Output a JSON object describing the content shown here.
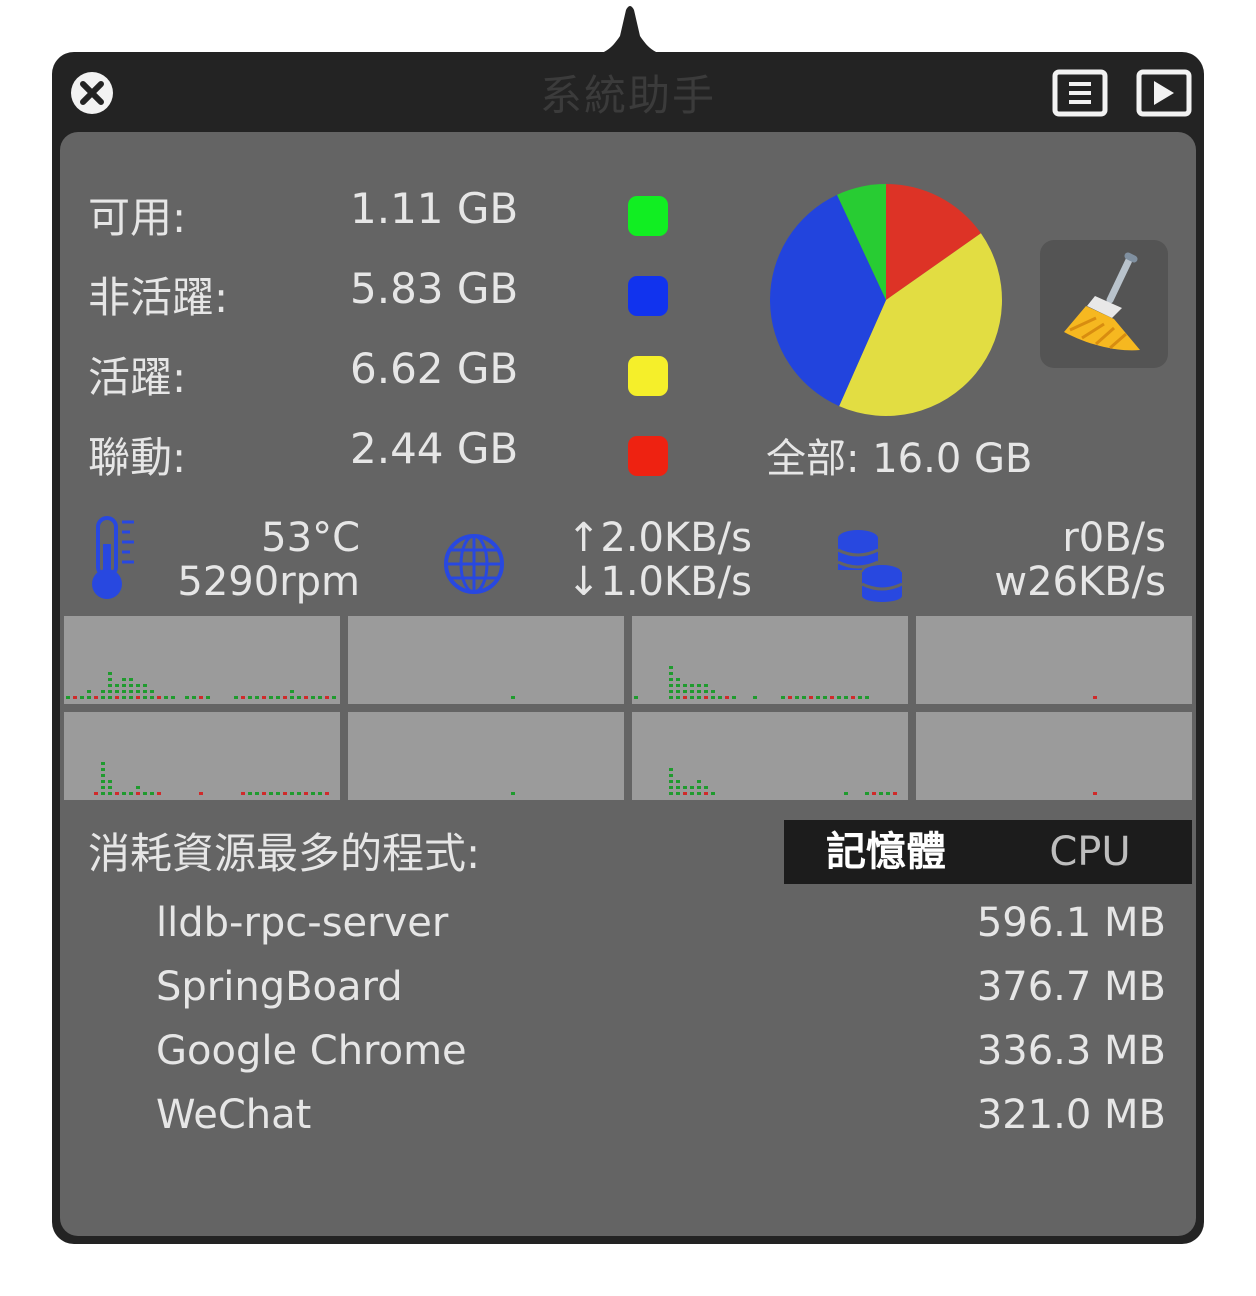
{
  "window": {
    "title": "系統助手"
  },
  "memory": {
    "rows": [
      {
        "label": "可用:",
        "value": "1.11 GB",
        "color": "#11ee22"
      },
      {
        "label": "非活躍:",
        "value": "5.83 GB",
        "color": "#1133ee"
      },
      {
        "label": "活躍:",
        "value": "6.62 GB",
        "color": "#f5ef2a"
      },
      {
        "label": "聯動:",
        "value": "2.44 GB",
        "color": "#ee2211"
      }
    ],
    "total_label": "全部:",
    "total_value": "16.0 GB",
    "pie": {
      "slices": [
        {
          "name": "聯動",
          "value": 2.44,
          "color": "#dd3326"
        },
        {
          "name": "活躍",
          "value": 6.62,
          "color": "#e2dd42"
        },
        {
          "name": "非活躍",
          "value": 5.83,
          "color": "#2244dd"
        },
        {
          "name": "可用",
          "value": 1.11,
          "color": "#28cc33"
        }
      ]
    }
  },
  "sensors": {
    "temperature": "53°C",
    "fan": "5290rpm",
    "net_up": "↑2.0KB/s",
    "net_down": "↓1.0KB/s",
    "disk_read": "r0B/s",
    "disk_write": "w26KB/s"
  },
  "icons": {
    "close": "close-icon",
    "list": "list-icon",
    "play": "play-icon",
    "broom": "broom-icon",
    "thermometer": "thermometer-icon",
    "globe": "globe-icon",
    "disk": "disk-icon"
  },
  "cpu_graphs": {
    "core_bars": [
      [
        1,
        1,
        1,
        2,
        1,
        2,
        5,
        3,
        4,
        4,
        3,
        3,
        2,
        1,
        1,
        1,
        0,
        1,
        1,
        1,
        1,
        0,
        0,
        0,
        1,
        1,
        1,
        1,
        1,
        1,
        1,
        1,
        2,
        1,
        1,
        1,
        1,
        1,
        1
      ],
      [
        0,
        0,
        0,
        0,
        0,
        0,
        0,
        0,
        0,
        0,
        0,
        0,
        0,
        0,
        0,
        0,
        0,
        0,
        0,
        0,
        0,
        0,
        0,
        1,
        0,
        0,
        0,
        0,
        0,
        0,
        0,
        0,
        0,
        0,
        0,
        0,
        0,
        0,
        0
      ],
      [
        1,
        0,
        0,
        0,
        0,
        6,
        4,
        3,
        3,
        3,
        3,
        2,
        1,
        1,
        1,
        0,
        0,
        1,
        0,
        0,
        0,
        1,
        1,
        1,
        1,
        1,
        1,
        1,
        1,
        1,
        1,
        1,
        1,
        1,
        0,
        0,
        0,
        0,
        0
      ],
      [
        0,
        0,
        0,
        0,
        0,
        0,
        0,
        0,
        0,
        0,
        0,
        0,
        0,
        0,
        0,
        0,
        0,
        0,
        0,
        0,
        0,
        0,
        0,
        0,
        0,
        1,
        0,
        0,
        0,
        0,
        0,
        0,
        0,
        0,
        0,
        0,
        0,
        0,
        0
      ],
      [
        0,
        0,
        0,
        0,
        1,
        6,
        3,
        1,
        1,
        1,
        2,
        1,
        1,
        1,
        0,
        0,
        0,
        0,
        0,
        1,
        0,
        0,
        0,
        0,
        0,
        1,
        1,
        1,
        1,
        1,
        1,
        1,
        1,
        1,
        1,
        1,
        1,
        1,
        0
      ],
      [
        0,
        0,
        0,
        0,
        0,
        0,
        0,
        0,
        0,
        0,
        0,
        0,
        0,
        0,
        0,
        0,
        0,
        0,
        0,
        0,
        0,
        0,
        0,
        1,
        0,
        0,
        0,
        0,
        0,
        0,
        0,
        0,
        0,
        0,
        0,
        0,
        0,
        0,
        0
      ],
      [
        0,
        0,
        0,
        0,
        0,
        5,
        3,
        2,
        2,
        3,
        2,
        1,
        0,
        0,
        0,
        0,
        0,
        0,
        0,
        0,
        0,
        0,
        0,
        0,
        0,
        0,
        0,
        0,
        0,
        0,
        1,
        0,
        0,
        1,
        1,
        1,
        1,
        1,
        0
      ],
      [
        0,
        0,
        0,
        0,
        0,
        0,
        0,
        0,
        0,
        0,
        0,
        0,
        0,
        0,
        0,
        0,
        0,
        0,
        0,
        0,
        0,
        0,
        0,
        0,
        0,
        1,
        0,
        0,
        0,
        0,
        0,
        0,
        0,
        0,
        0,
        0,
        0,
        0,
        0
      ]
    ]
  },
  "top_processes": {
    "label": "消耗資源最多的程式:",
    "tabs": [
      {
        "label": "記憶體",
        "active": true
      },
      {
        "label": "CPU",
        "active": false
      }
    ],
    "rows": [
      {
        "name": "lldb-rpc-server",
        "value": "596.1 MB"
      },
      {
        "name": "SpringBoard",
        "value": "376.7 MB"
      },
      {
        "name": "Google Chrome",
        "value": "336.3 MB"
      },
      {
        "name": "WeChat",
        "value": "321.0 MB"
      }
    ]
  }
}
